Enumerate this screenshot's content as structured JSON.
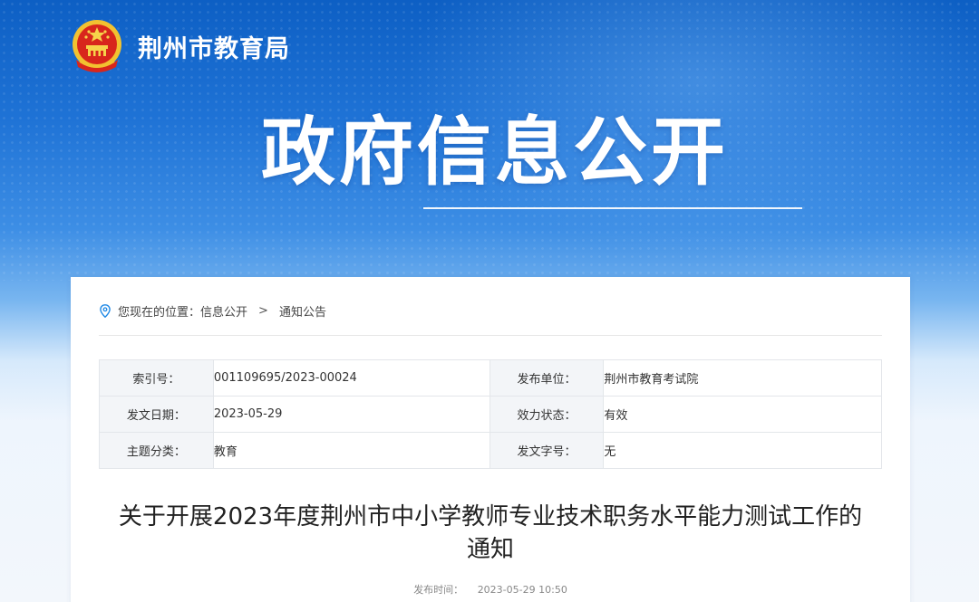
{
  "header": {
    "site_title": "荆州市教育局",
    "emblem_icon": "national-emblem-icon"
  },
  "hero": {
    "title": "政府信息公开"
  },
  "breadcrumb": {
    "icon": "location-pin-icon",
    "prefix": "您现在的位置：",
    "item1": "信息公开",
    "separator": ">",
    "item2": "通知公告"
  },
  "meta": {
    "rows": [
      {
        "label1": "索引号：",
        "value1": "001109695/2023-00024",
        "label2": "发布单位：",
        "value2": "荆州市教育考试院"
      },
      {
        "label1": "发文日期：",
        "value1": "2023-05-29",
        "label2": "效力状态：",
        "value2": "有效"
      },
      {
        "label1": "主题分类：",
        "value1": "教育",
        "label2": "发文字号：",
        "value2": "无"
      }
    ]
  },
  "document": {
    "title_line1": "关于开展2023年度荆州市中小学教师专业技术职务水平能力测试工作的",
    "title_line2": "通知",
    "publish_label": "发布时间：",
    "publish_time": "2023-05-29 10:50"
  },
  "colors": {
    "banner_top": "#0d5fc4",
    "banner_mid": "#3d8ee5",
    "card_bg": "#ffffff",
    "label_bg": "#f3f5f8",
    "pin_color": "#1e88e5"
  }
}
